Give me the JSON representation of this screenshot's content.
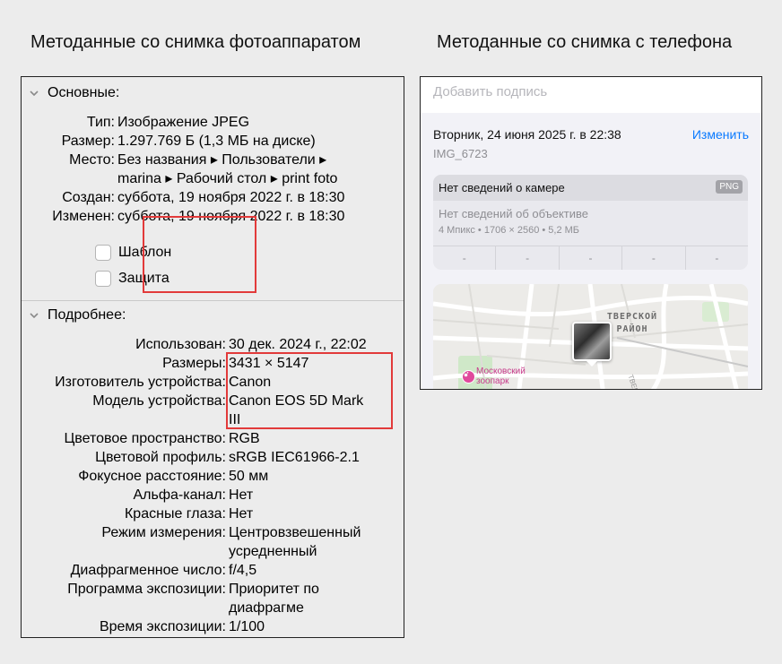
{
  "captions": {
    "left": "Методанные со снимка фотоаппаратом",
    "right": "Методанные со снимка с телефона"
  },
  "mac_info": {
    "basic": {
      "title": "Основные:",
      "rows": [
        {
          "label": "Тип:",
          "value": "Изображение JPEG"
        },
        {
          "label": "Размер:",
          "value": "1.297.769 Б (1,3 МБ на диске)"
        },
        {
          "label": "Место:",
          "value": "Без названия ▸ Пользователи ▸\nmarina ▸ Рабочий стол ▸ print foto"
        },
        {
          "label": "Создан:",
          "value": "суббота, 19 ноября 2022 г. в 18:30"
        },
        {
          "label": "Изменен:",
          "value": "суббота, 19 ноября 2022 г. в 18:30"
        }
      ],
      "checkboxes": [
        {
          "label": "Шаблон",
          "checked": false
        },
        {
          "label": "Защита",
          "checked": false
        }
      ]
    },
    "detail": {
      "title": "Подробнее:",
      "rows": [
        {
          "label": "Использован:",
          "value": "30 дек. 2024 г., 22:02"
        },
        {
          "label": "Размеры:",
          "value": "3431 × 5147"
        },
        {
          "label": "Изготовитель устройства:",
          "value": "Canon"
        },
        {
          "label": "Модель устройства:",
          "value": "Canon EOS 5D Mark\nIII"
        },
        {
          "label": "Цветовое пространство:",
          "value": "RGB"
        },
        {
          "label": "Цветовой профиль:",
          "value": "sRGB IEC61966-2.1"
        },
        {
          "label": "Фокусное расстояние:",
          "value": "50 мм"
        },
        {
          "label": "Альфа-канал:",
          "value": "Нет"
        },
        {
          "label": "Красные глаза:",
          "value": "Нет"
        },
        {
          "label": "Режим измерения:",
          "value": "Центровзвешенный\nусредненный"
        },
        {
          "label": "Диафрагменное число:",
          "value": "f/4,5"
        },
        {
          "label": "Программа экспозиции:",
          "value": "Приоритет по\nдиафрагме"
        },
        {
          "label": "Время экспозиции:",
          "value": "1/100"
        }
      ]
    }
  },
  "ios_info": {
    "caption_placeholder": "Добавить подпись",
    "datetime": "Вторник, 24 июня 2025 г. в 22:38",
    "edit_label": "Изменить",
    "filename": "IMG_6723",
    "camera_title": "Нет сведений о камере",
    "format_badge": "PNG",
    "lens": "Нет сведений об объективе",
    "specs": "4 Мпикс • 1706 × 2560 • 5,2 МБ",
    "stats": [
      "-",
      "-",
      "-",
      "-",
      "-"
    ],
    "map": {
      "district": "ТВЕРСКОЙ\nРАЙОН",
      "zoo": "Московский\nзоопарк",
      "street": "ТВЕР"
    }
  },
  "colors": {
    "highlight": "#e23a3a",
    "ios_link": "#0a7aff",
    "zoo_pin": "#e0499c"
  }
}
